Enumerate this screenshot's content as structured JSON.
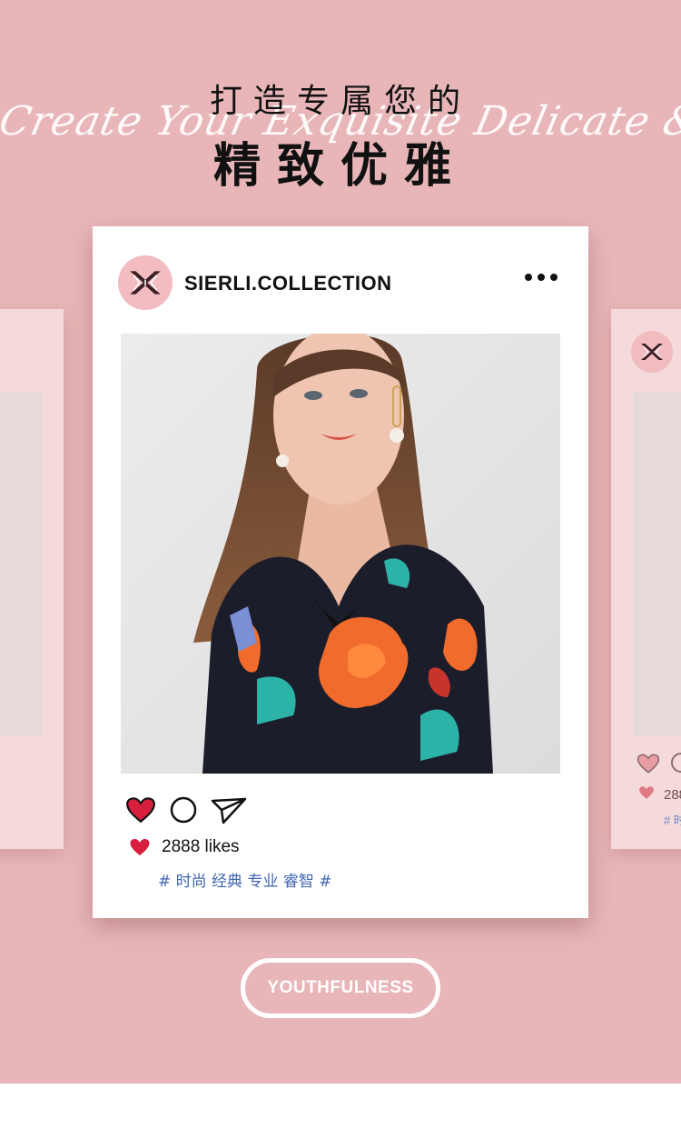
{
  "header": {
    "title_small": "打造专属您的",
    "title_big": "精致优雅",
    "script_text": "Create Your Exquisite Delicate & Elegance"
  },
  "post": {
    "account_name": "SIERLI.COLLECTION",
    "likes": "2888 likes",
    "tags": "# 时尚 经典 专业 睿智 #"
  },
  "side_card_right": {
    "likes_partial": "288",
    "tags_partial": "# 时"
  },
  "button": {
    "label": "YOUTHFULNESS"
  },
  "colors": {
    "background_pink": "#e8b6b8",
    "side_card": "#f5dadb",
    "avatar_pink": "#f2bcc0",
    "heart_red": "#d81f3f",
    "tag_blue": "#3f66b0"
  },
  "icons": [
    "brand-logo-icon",
    "more-options-icon",
    "heart-icon",
    "comment-icon",
    "share-icon"
  ]
}
